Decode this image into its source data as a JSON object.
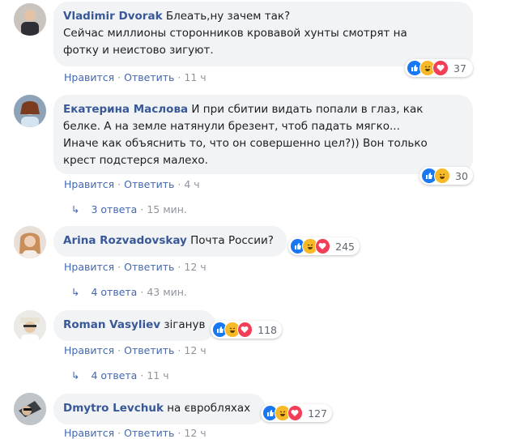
{
  "labels": {
    "like": "Нравится",
    "reply": "Ответить",
    "sep": "·"
  },
  "comments": [
    {
      "author": "Vladimir Dvorak",
      "text": "Блеать,ну зачем так?\nСейчас миллионы сторонников кровавой хунты смотрят на\nфотку и неистово зигуют.",
      "time": "11 ч",
      "reactions": {
        "icons": [
          "like-icon",
          "haha-icon",
          "love-icon"
        ],
        "count": "37"
      }
    },
    {
      "author": "Екатерина Маслова",
      "text": "И при сбитии видать попали в глаз, как\nбелке. А на земле натянули брезент, чтоб падать мягко...\nИначе как объяснить то, что он совершенно цел?)) Вон только\nкрест подстерся малехо.",
      "time": "4 ч",
      "reactions": {
        "icons": [
          "like-icon",
          "haha-icon"
        ],
        "count": "30"
      },
      "replies": {
        "count": "3 ответа",
        "time": "15 мин."
      }
    },
    {
      "author": "Arina Rozvadovskay",
      "text": "Почта России?",
      "time": "12 ч",
      "reactions": {
        "icons": [
          "like-icon",
          "haha-icon",
          "love-icon"
        ],
        "count": "245"
      },
      "replies": {
        "count": "4 ответа",
        "time": "43 мин."
      }
    },
    {
      "author": "Roman Vasyliev",
      "text": "зіганув",
      "time": "12 ч",
      "reactions": {
        "icons": [
          "like-icon",
          "haha-icon",
          "love-icon"
        ],
        "count": "118"
      },
      "replies": {
        "count": "4 ответа",
        "time": "11 ч"
      }
    },
    {
      "author": "Dmytro Levchuk",
      "text": "на євробляхах",
      "time": "12 ч",
      "reactions": {
        "icons": [
          "like-icon",
          "haha-icon",
          "love-icon"
        ],
        "count": "127"
      }
    }
  ],
  "colors": {
    "link": "#385898",
    "action": "#4267b2",
    "muted": "#90949c",
    "bubble": "#f2f3f5"
  }
}
